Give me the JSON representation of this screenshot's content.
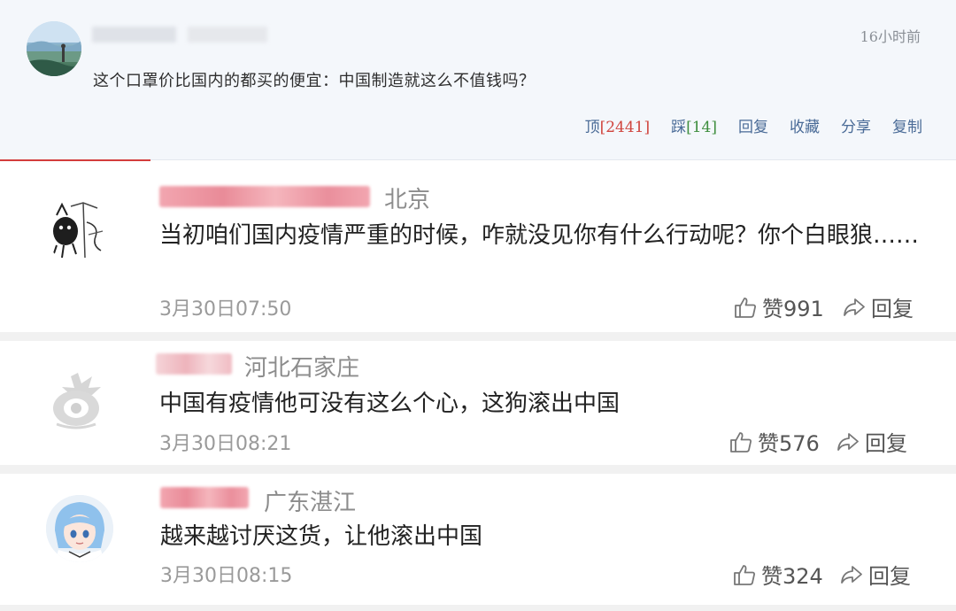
{
  "top_comment": {
    "time": "16小时前",
    "text": "这个口罩价比国内的都买的便宜：中国制造就这么不值钱吗？",
    "actions": {
      "up_label": "顶",
      "up_count": "[2441]",
      "down_label": "踩",
      "down_count": "[14]",
      "reply": "回复",
      "favorite": "收藏",
      "share": "分享",
      "copy": "复制"
    }
  },
  "replies": [
    {
      "location": "北京",
      "text": "当初咱们国内疫情严重的时候，咋就没见你有什么行动呢？你个白眼狼……",
      "time": "3月30日07:50",
      "likes": "赞991",
      "reply": "回复"
    },
    {
      "location": "河北石家庄",
      "text": "中国有疫情他可没有这么个心，这狗滚出中国",
      "time": "3月30日08:21",
      "likes": "赞576",
      "reply": "回复"
    },
    {
      "location": "广东湛江",
      "text": "越来越讨厌这货，让他滚出中国",
      "time": "3月30日08:15",
      "likes": "赞324",
      "reply": "回复"
    }
  ],
  "icons": {
    "like": "thumbs-up-icon",
    "reply": "share-arrow-icon"
  },
  "colors": {
    "top_card_bg": "#f4f7fb",
    "action_blue": "#4a6b97",
    "count_red": "#d0453e",
    "count_green": "#3e8e3e",
    "accent": "#d33c3c"
  }
}
